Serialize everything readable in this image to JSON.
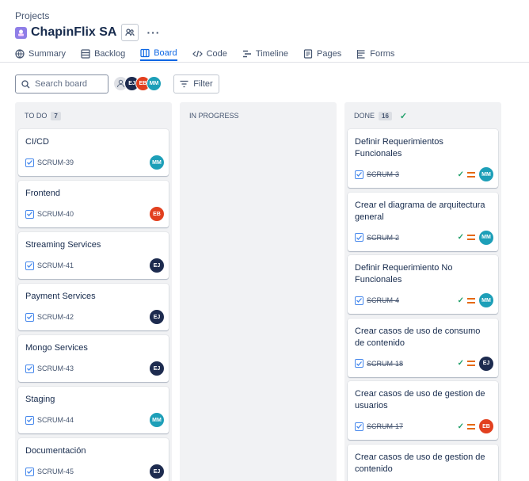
{
  "breadcrumb": "Projects",
  "project": {
    "title": "ChapinFlix SA",
    "more": "···"
  },
  "tabs": [
    {
      "label": "Summary",
      "icon": "globe-icon",
      "active": false
    },
    {
      "label": "Backlog",
      "icon": "backlog-icon",
      "active": false
    },
    {
      "label": "Board",
      "icon": "board-icon",
      "active": true
    },
    {
      "label": "Code",
      "icon": "code-icon",
      "active": false
    },
    {
      "label": "Timeline",
      "icon": "timeline-icon",
      "active": false
    },
    {
      "label": "Pages",
      "icon": "pages-icon",
      "active": false
    },
    {
      "label": "Forms",
      "icon": "forms-icon",
      "active": false
    }
  ],
  "toolbar": {
    "search_placeholder": "Search board",
    "filter_label": "Filter",
    "avatars": [
      {
        "initials": "",
        "color": "#dfe1e6"
      },
      {
        "initials": "EJ",
        "color": "#1d2b4f"
      },
      {
        "initials": "EB",
        "color": "#e2401f"
      },
      {
        "initials": "MM",
        "color": "#1d9fb8"
      }
    ]
  },
  "columns": {
    "todo": {
      "title": "TO DO",
      "count": "7",
      "cards": [
        {
          "title": "CI/CD",
          "key": "SCRUM-39",
          "assignee": "MM",
          "color": "#1d9fb8"
        },
        {
          "title": "Frontend",
          "key": "SCRUM-40",
          "assignee": "EB",
          "color": "#e2401f"
        },
        {
          "title": "Streaming Services",
          "key": "SCRUM-41",
          "assignee": "EJ",
          "color": "#1d2b4f"
        },
        {
          "title": "Payment Services",
          "key": "SCRUM-42",
          "assignee": "EJ",
          "color": "#1d2b4f"
        },
        {
          "title": "Mongo Services",
          "key": "SCRUM-43",
          "assignee": "EJ",
          "color": "#1d2b4f"
        },
        {
          "title": "Staging",
          "key": "SCRUM-44",
          "assignee": "MM",
          "color": "#1d9fb8"
        },
        {
          "title": "Documentación",
          "key": "SCRUM-45",
          "assignee": "EJ",
          "color": "#1d2b4f"
        }
      ]
    },
    "inprogress": {
      "title": "IN PROGRESS"
    },
    "done": {
      "title": "DONE",
      "count": "16",
      "check": "✓",
      "cards": [
        {
          "title": "Definir Requerimientos Funcionales",
          "key": "SCRUM-3",
          "assignee": "MM",
          "color": "#1d9fb8"
        },
        {
          "title": "Crear el diagrama de arquitectura general",
          "key": "SCRUM-2",
          "assignee": "MM",
          "color": "#1d9fb8"
        },
        {
          "title": "Definir Requerimiento No Funcionales",
          "key": "SCRUM-4",
          "assignee": "MM",
          "color": "#1d9fb8"
        },
        {
          "title": "Crear casos de uso de consumo de contenido",
          "key": "SCRUM-18",
          "assignee": "EJ",
          "color": "#1d2b4f"
        },
        {
          "title": "Crear casos de uso de gestion de usuarios",
          "key": "SCRUM-17",
          "assignee": "EB",
          "color": "#e2401f"
        },
        {
          "title": "Crear casos de uso de gestion de contenido",
          "key": "",
          "assignee": "",
          "color": ""
        }
      ]
    }
  }
}
